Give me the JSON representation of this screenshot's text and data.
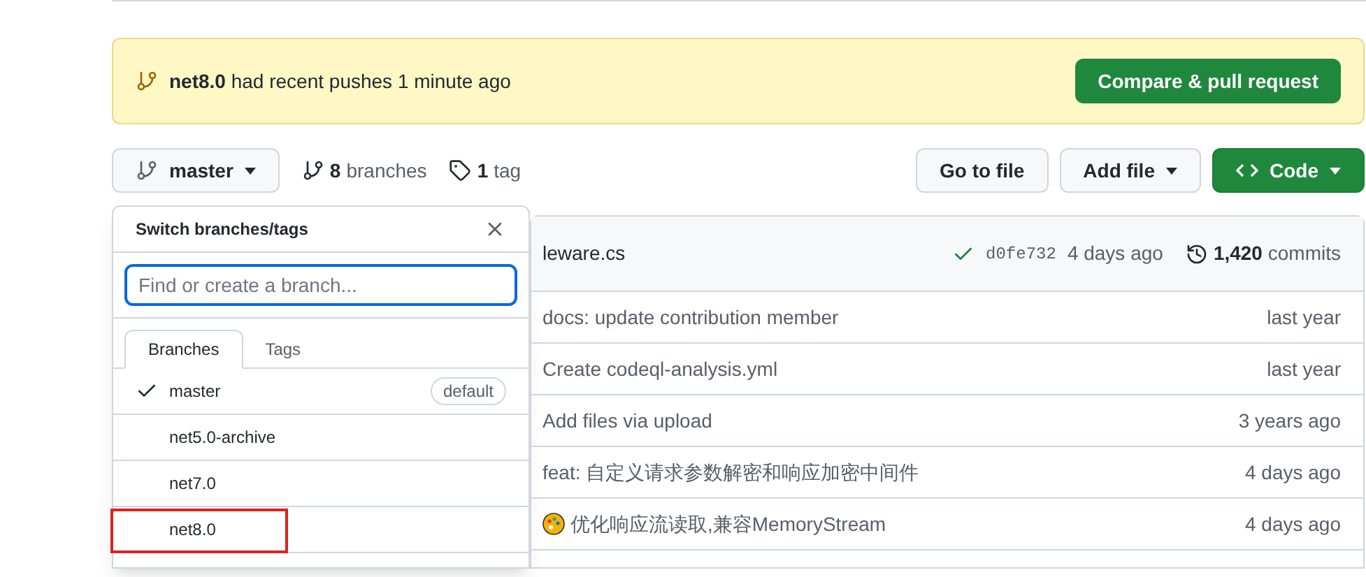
{
  "banner": {
    "branch": "net8.0",
    "message": "had recent pushes 1 minute ago",
    "button": "Compare & pull request"
  },
  "toolbar": {
    "branch_button": "master",
    "branches_count": "8",
    "branches_label": "branches",
    "tags_count": "1",
    "tags_label": "tag",
    "buttons": [
      {
        "label": "Go to file",
        "kind": "plain"
      },
      {
        "label": "Add file",
        "kind": "menu"
      },
      {
        "label": "Code",
        "kind": "primary"
      }
    ]
  },
  "latest_commit": {
    "file": "leware.cs",
    "hash": "d0fe732",
    "time": "4 days ago",
    "commits_count": "1,420",
    "commits_label": "commits"
  },
  "files": [
    {
      "message": "docs: update contribution member",
      "time": "last year",
      "has_icon": false
    },
    {
      "message": "Create codeql-analysis.yml",
      "time": "last year",
      "has_icon": false
    },
    {
      "message": "Add files via upload",
      "time": "3 years ago",
      "has_icon": false
    },
    {
      "message": "feat: 自定义请求参数解密和响应加密中间件",
      "time": "4 days ago",
      "has_icon": false
    },
    {
      "message": "优化响应流读取,兼容MemoryStream",
      "time": "4 days ago",
      "has_icon": true
    }
  ],
  "dropdown": {
    "title": "Switch branches/tags",
    "placeholder": "Find or create a branch...",
    "tabs": [
      {
        "label": "Branches",
        "selected": true
      },
      {
        "label": "Tags",
        "selected": false
      }
    ],
    "branches": [
      {
        "name": "master",
        "selected": true,
        "badge": "default",
        "highlighted": false
      },
      {
        "name": "net5.0-archive",
        "selected": false,
        "highlighted": false
      },
      {
        "name": "net7.0",
        "selected": false,
        "highlighted": false
      },
      {
        "name": "net8.0",
        "selected": false,
        "highlighted": true
      }
    ]
  }
}
